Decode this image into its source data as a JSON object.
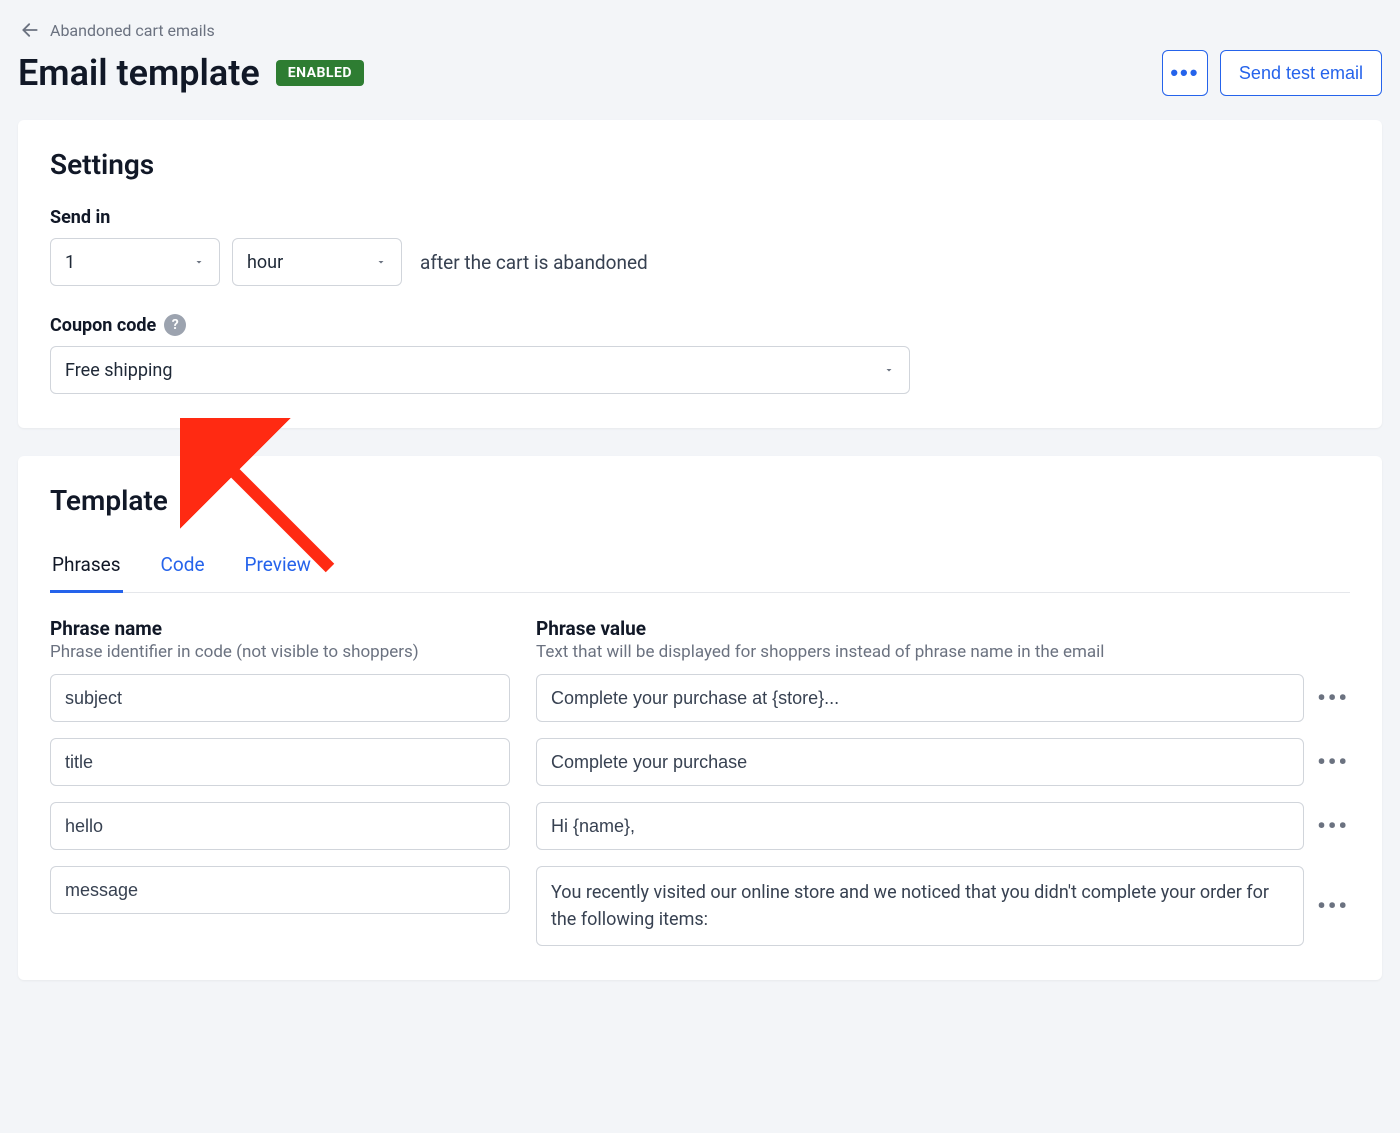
{
  "breadcrumb": {
    "label": "Abandoned cart emails"
  },
  "title": "Email template",
  "status_badge": "ENABLED",
  "actions": {
    "send_test": "Send test email"
  },
  "settings": {
    "heading": "Settings",
    "send_in_label": "Send in",
    "send_in_value": "1",
    "send_in_unit": "hour",
    "after_text": "after the cart is abandoned",
    "coupon_label": "Coupon code",
    "coupon_value": "Free shipping"
  },
  "template": {
    "heading": "Template",
    "tabs": [
      "Phrases",
      "Code",
      "Preview"
    ],
    "col_name_head": "Phrase name",
    "col_name_sub": "Phrase identifier in code (not visible to shoppers)",
    "col_value_head": "Phrase value",
    "col_value_sub": "Text that will be displayed for shoppers instead of phrase name in the email",
    "rows": [
      {
        "name": "subject",
        "value": "Complete your purchase at {store}..."
      },
      {
        "name": "title",
        "value": "Complete your purchase"
      },
      {
        "name": "hello",
        "value": "Hi {name},"
      },
      {
        "name": "message",
        "value": "You recently visited our online store and we noticed that you didn't complete your order for the following items:"
      }
    ]
  }
}
